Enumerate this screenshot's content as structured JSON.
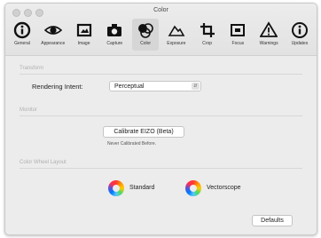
{
  "window": {
    "title": "Color"
  },
  "toolbar": {
    "items": [
      {
        "label": "General",
        "icon": "info-icon"
      },
      {
        "label": "Appearance",
        "icon": "eye-icon"
      },
      {
        "label": "Image",
        "icon": "image-icon"
      },
      {
        "label": "Capture",
        "icon": "camera-icon"
      },
      {
        "label": "Color",
        "icon": "color-icon"
      },
      {
        "label": "Exposure",
        "icon": "exposure-icon"
      },
      {
        "label": "Crop",
        "icon": "crop-icon"
      },
      {
        "label": "Focus",
        "icon": "focus-icon"
      },
      {
        "label": "Warnings",
        "icon": "warning-icon"
      },
      {
        "label": "Updates",
        "icon": "updates-icon"
      }
    ],
    "selected": "Color"
  },
  "transform": {
    "section_title": "Transform",
    "rendering_label": "Rendering Intent:",
    "rendering_value": "Perceptual"
  },
  "monitor": {
    "section_title": "Monitor",
    "calibrate_label": "Calibrate EIZO (Beta)",
    "note": "Never Calibrated Before."
  },
  "color_wheel": {
    "section_title": "Color Wheel Layout",
    "option_standard": "Standard",
    "option_vectorscope": "Vectorscope"
  },
  "footer": {
    "defaults_label": "Defaults"
  }
}
